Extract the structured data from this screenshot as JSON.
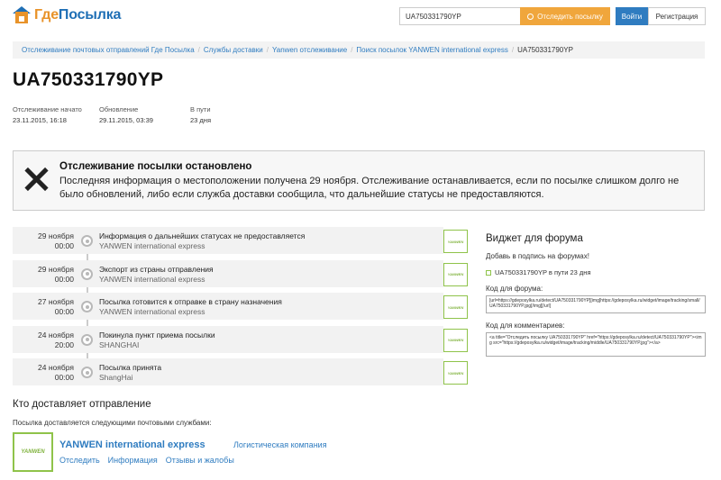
{
  "header": {
    "logo_part1": "Где",
    "logo_part2": "Посылка",
    "search_value": "UA750331790YP",
    "track_button": "Отследить посылку",
    "login_button": "Войти",
    "register_button": "Регистрация"
  },
  "breadcrumb": {
    "items": [
      "Отслеживание почтовых отправлений Где Посылка",
      "Службы доставки",
      "Yanwen отслеживание",
      "Поиск посылок YANWEN international express"
    ],
    "current": "UA750331790YP"
  },
  "parcel": {
    "tracking_number": "UA750331790YP",
    "started_label": "Отслеживание начато",
    "started_value": "23.11.2015, 16:18",
    "updated_label": "Обновление",
    "updated_value": "29.11.2015, 03:39",
    "transit_label": "В пути",
    "transit_value": "23 дня"
  },
  "alert": {
    "title": "Отслеживание посылки остановлено",
    "message": "Последняя информация о местоположении получена 29 ноября. Отслеживание останавливается, если по посылке слишком долго не было обновлений, либо если служба доставки сообщила, что дальнейшие статусы не предоставляются."
  },
  "events": [
    {
      "date": "29 ноября",
      "time": "00:00",
      "title": "Информация о дальнейших статусах не предоставляется",
      "sub": "YANWEN international express",
      "icon": "YANWEN"
    },
    {
      "date": "29 ноября",
      "time": "00:00",
      "title": "Экспорт из страны отправления",
      "sub": "YANWEN international express",
      "icon": "YANWEN"
    },
    {
      "date": "27 ноября",
      "time": "00:00",
      "title": "Посылка готовится к отправке в страну назначения",
      "sub": "YANWEN international express",
      "icon": "YANWEN"
    },
    {
      "date": "24 ноября",
      "time": "20:00",
      "title": "Покинула пункт приема посылки",
      "sub": "SHANGHAI",
      "icon": "YANWEN"
    },
    {
      "date": "24 ноября",
      "time": "00:00",
      "title": "Посылка принята",
      "sub": "ShangHai",
      "icon": "YANWEN"
    }
  ],
  "widget": {
    "title": "Виджет для форума",
    "subtitle": "Добавь в подпись на форумах!",
    "preview": "UA750331790YP в пути 23 дня",
    "forum_label": "Код для форума:",
    "forum_code": "[url=https://gdeposylka.ru/detect/UA750331790YP][img]https://gdeposylka.ru/widget/image/tracking/small/UA750331790YP.jpg[/img][/url]",
    "comment_label": "Код для комментариев:",
    "comment_code": "<a title=\"Отследить посылку UA750331790YP\" href=\"https://gdeposylka.ru/detect/UA750331790YP\"><img src=\"https://gdeposylka.ru/widget/image/tracking/middle/UA750331790YP.jpg\"></a>"
  },
  "carrier": {
    "section_title": "Кто доставляет отправление",
    "section_sub": "Посылка доставляется следующими почтовыми службами:",
    "logo_text": "YANWEN",
    "name": "YANWEN international express",
    "type": "Логистическая компания",
    "links": [
      "Отследить",
      "Информация",
      "Отзывы и жалобы"
    ]
  },
  "colors": {
    "brand_orange": "#e8932a",
    "brand_blue": "#1f6fb5",
    "link_blue": "#2f7cc0",
    "carrier_green": "#8fc34a"
  }
}
